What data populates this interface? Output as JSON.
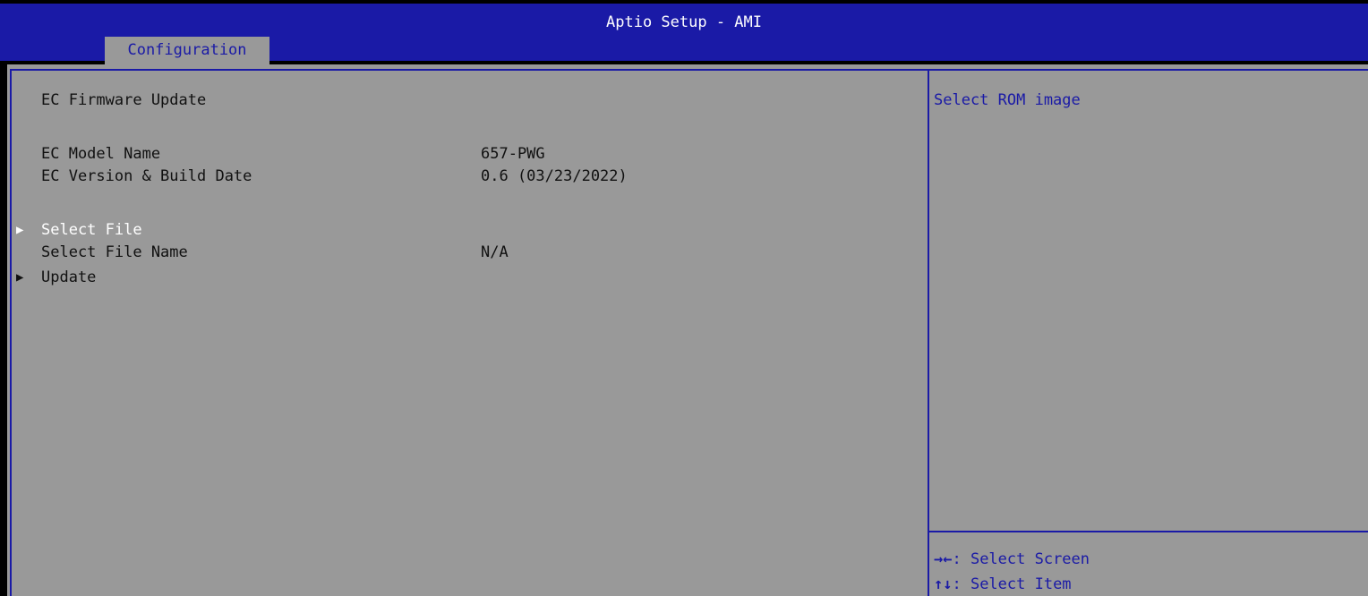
{
  "header": {
    "app_title": "Aptio Setup - AMI",
    "active_tab": "Configuration"
  },
  "main": {
    "section_title": "EC Firmware Update",
    "items": [
      {
        "label": "EC Model Name",
        "value": "657-PWG"
      },
      {
        "label": "EC Version & Build Date",
        "value": "0.6 (03/23/2022)"
      }
    ],
    "select_file": {
      "label": "Select File",
      "arrow": "▶"
    },
    "select_file_name": {
      "label": "Select File Name",
      "value": "N/A"
    },
    "update": {
      "label": "Update",
      "arrow": "▶"
    }
  },
  "help": {
    "description": "Select ROM image",
    "keys": [
      {
        "glyph": "→←",
        "text": ": Select Screen"
      },
      {
        "glyph": "↑↓",
        "text": ": Select Item"
      }
    ]
  },
  "colors": {
    "header_blue": "#1a1aa6",
    "panel_gray": "#999999",
    "selected_text": "#ffffff",
    "normal_text": "#111111"
  }
}
